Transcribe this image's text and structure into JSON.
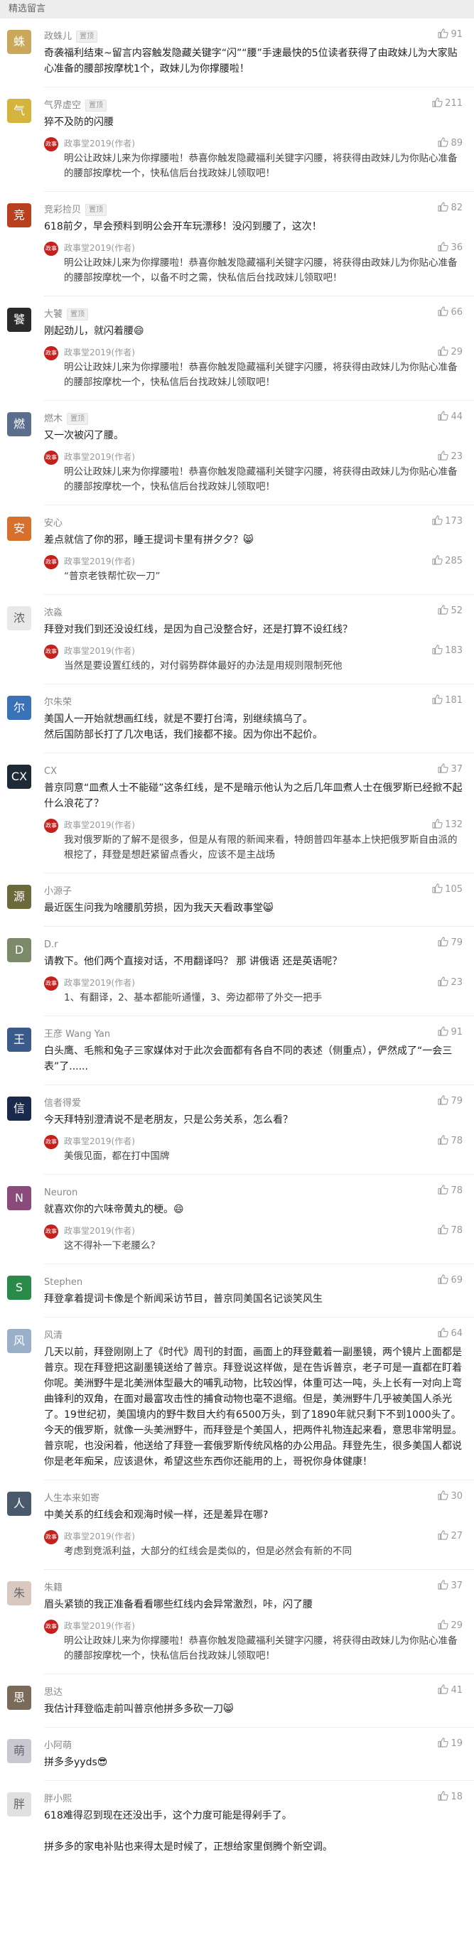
{
  "header": {
    "title": "精选留言"
  },
  "reply_author": "政事堂2019(作者)",
  "reply_avatar_text": "政事堂",
  "comments": [
    {
      "name": "政蛛儿",
      "badge": "置顶",
      "likes": "91",
      "avatar_color": "#c9a85c",
      "avatar_glyph": "蛛",
      "text": "奇袭福利结束~留言内容触发隐藏关键字“闪”“腰”手速最快的5位读者获得了由政妹儿为大家贴心准备的腰部按摩枕1个，政妹儿为你撑腰啦！",
      "replies": []
    },
    {
      "name": "气界虚空",
      "badge": "置顶",
      "likes": "211",
      "avatar_color": "#d4b43c",
      "avatar_glyph": "气",
      "text": "猝不及防的闪腰",
      "replies": [
        {
          "likes": "89",
          "text": "明公让政妹儿来为你撑腰啦！恭喜你触发隐藏福利关键字闪腰，将获得由政妹儿为你贴心准备的腰部按摩枕一个，快私信后台找政妹儿领取吧！"
        }
      ]
    },
    {
      "name": "竞彩捡贝",
      "badge": "置顶",
      "likes": "82",
      "avatar_color": "#b8401e",
      "avatar_glyph": "竞",
      "text": "618前夕，早会预料到明公会开车玩漂移！没闪到腰了，这次！",
      "replies": [
        {
          "likes": "36",
          "text": "明公让政妹儿来为你撑腰啦！恭喜你触发隐藏福利关键字闪腰，将获得由政妹儿为你贴心准备的腰部按摩枕一个，以备不时之需，快私信后台找政妹儿领取吧！"
        }
      ]
    },
    {
      "name": "大饕",
      "badge": "置顶",
      "likes": "66",
      "avatar_color": "#2a2a2a",
      "avatar_glyph": "饕",
      "text": "刚起劲儿，就闪着腰😄",
      "replies": [
        {
          "likes": "29",
          "text": "明公让政妹儿来为你撑腰啦！恭喜你触发隐藏福利关键字闪腰，将获得由政妹儿为你贴心准备的腰部按摩枕一个，快私信后台找政妹儿领取吧！"
        }
      ]
    },
    {
      "name": "燃木",
      "badge": "置顶",
      "likes": "44",
      "avatar_color": "#5c6e8e",
      "avatar_glyph": "燃",
      "text": "又一次被闪了腰。",
      "replies": [
        {
          "likes": "23",
          "text": "明公让政妹儿来为你撑腰啦！恭喜你触发隐藏福利关键字闪腰，将获得由政妹儿为你贴心准备的腰部按摩枕一个，快私信后台找政妹儿领取吧！"
        }
      ]
    },
    {
      "name": "安心",
      "badge": "",
      "likes": "173",
      "avatar_color": "#d6702c",
      "avatar_glyph": "安",
      "text": "差点就信了你的邪，睡王提词卡里有拼夕夕？😸",
      "replies": [
        {
          "likes": "285",
          "text": "“普京老铁帮忙砍一刀”"
        }
      ]
    },
    {
      "name": "浓淼",
      "badge": "",
      "likes": "52",
      "avatar_color": "#e8e8e8",
      "avatar_glyph": "浓",
      "text": "拜登对我们到还没设红线，是因为自己没整合好，还是打算不设红线？",
      "replies": [
        {
          "likes": "183",
          "text": "当然是要设置红线的，对付弱势群体最好的办法是用规则限制死他"
        }
      ]
    },
    {
      "name": "尔朱荣",
      "badge": "",
      "likes": "181",
      "avatar_color": "#3a72b8",
      "avatar_glyph": "尔",
      "text": "美国人一开始就想画红线，就是不要打台湾，别继续搞乌了。\n然后国防部长打了几次电话，我们接都不接。因为你出不起价。",
      "replies": []
    },
    {
      "name": "CX",
      "badge": "",
      "likes": "37",
      "avatar_color": "#1e2a36",
      "avatar_glyph": "CX",
      "text": "普京同意“皿煮人士不能碰”这条红线，是不是暗示他认为之后几年皿煮人士在俄罗斯已经掀不起什么浪花了？",
      "replies": [
        {
          "likes": "132",
          "text": "我对俄罗斯的了解不是很多，但是从有限的新闻来看，特朗普四年基本上快把俄罗斯自由派的根挖了，拜登是想赶紧留点香火，应该不是主战场"
        }
      ]
    },
    {
      "name": "小源子",
      "badge": "",
      "likes": "105",
      "avatar_color": "#6a6a3a",
      "avatar_glyph": "源",
      "text": "最近医生问我为啥腰肌劳损，因为我天天看政事堂😸",
      "replies": []
    },
    {
      "name": "D.r",
      "badge": "",
      "likes": "79",
      "avatar_color": "#7a8a6a",
      "avatar_glyph": "D",
      "text": "请教下。他们两个直接对话，不用翻译吗？ 那 讲俄语 还是英语呢？",
      "replies": [
        {
          "likes": "23",
          "text": "1、有翻译，2、基本都能听通懂，3、旁边都带了外交一把手"
        }
      ]
    },
    {
      "name": "王彦 Wang Yan",
      "badge": "",
      "likes": "91",
      "avatar_color": "#3a5a8a",
      "avatar_glyph": "王",
      "text": "白头鹰、毛熊和兔子三家媒体对于此次会面都有各自不同的表述（侧重点），俨然成了“一会三表”了......",
      "replies": []
    },
    {
      "name": "信者得爱",
      "badge": "",
      "likes": "79",
      "avatar_color": "#1a2a4a",
      "avatar_glyph": "信",
      "text": "今天拜特别澄清说不是老朋友，只是公务关系，怎么看？",
      "replies": [
        {
          "likes": "78",
          "text": "美俄见面，都在打中国牌"
        }
      ]
    },
    {
      "name": "Neuron",
      "badge": "",
      "likes": "78",
      "avatar_color": "#8a4a7a",
      "avatar_glyph": "N",
      "text": "就喜欢你的六味帝黄丸的梗。😄",
      "replies": [
        {
          "likes": "78",
          "text": "这不得补一下老腰么？"
        }
      ]
    },
    {
      "name": "Stephen",
      "badge": "",
      "likes": "69",
      "avatar_color": "#2a8a4a",
      "avatar_glyph": "S",
      "text": "拜登拿着提词卡像是个新闻采访节目，普京同美国名记谈笑风生",
      "replies": []
    },
    {
      "name": "风清",
      "badge": "",
      "likes": "64",
      "avatar_color": "#9ab0c8",
      "avatar_glyph": "风",
      "text": "几天以前，拜登刚刚上了《时代》周刊的封面，画面上的拜登戴着一副墨镜，两个镜片上面都是普京。现在拜登把这副墨镜送给了普京。拜登说这样做，是在告诉普京，老子可是一直都在盯着你呢。美洲野牛是北美洲体型最大的哺乳动物，比较凶悍，体重可达一吨，头上长有一对向上弯曲锋利的双角，在面对最富攻击性的捕食动物也毫不退缩。但是，美洲野牛几乎被美国人杀光了。19世纪初，美国境内的野牛数目大约有6500万头，到了1890年就只剩下不到1000头了。今天的俄罗斯，就像一头美洲野牛，而拜登是个美国人，把两件礼物连起来看，意思非常明显。普京呢，也没闲着，他送给了拜登一套俄罗斯传统风格的办公用品。拜登先生，很多美国人都说你是老年痴呆，应该退休，希望这些东西你还能用的上，哥祝你身体健康！",
      "replies": []
    },
    {
      "name": "人生本来如寄",
      "badge": "",
      "likes": "30",
      "avatar_color": "#4a5a6a",
      "avatar_glyph": "人",
      "text": "中美关系的红线会和观海时候一样，还是差异在哪?",
      "replies": [
        {
          "likes": "27",
          "text": "考虑到竞派利益，大部分的红线会是类似的，但是必然会有新的不同"
        }
      ]
    },
    {
      "name": "朱籍",
      "badge": "",
      "likes": "37",
      "avatar_color": "#d8c8c0",
      "avatar_glyph": "朱",
      "text": "眉头紧锁的我正准备看看哪些红线内会异常激烈，咔，闪了腰",
      "replies": [
        {
          "likes": "29",
          "text": "明公让政妹儿来为你撑腰啦！恭喜你触发隐藏福利关键字闪腰，将获得由政妹儿为你贴心准备的腰部按摩枕一个，快私信后台找政妹儿领取吧！"
        }
      ]
    },
    {
      "name": "思达",
      "badge": "",
      "likes": "41",
      "avatar_color": "#7a6a5a",
      "avatar_glyph": "思",
      "text": "我估计拜登临走前叫普京他拼多多砍一刀😸",
      "replies": []
    },
    {
      "name": "小阿萌",
      "badge": "",
      "likes": "19",
      "avatar_color": "#c8c8d0",
      "avatar_glyph": "萌",
      "text": "拼多多yyds😎",
      "replies": []
    },
    {
      "name": "胖小熙",
      "badge": "",
      "likes": "18",
      "avatar_color": "#e0e0e0",
      "avatar_glyph": "胖",
      "text": "618难得忍到现在还没出手，这个力度可能是得剁手了。\n\n拼多多的家电补贴也来得太是时候了，正想给家里倒腾个新空调。",
      "replies": []
    }
  ]
}
